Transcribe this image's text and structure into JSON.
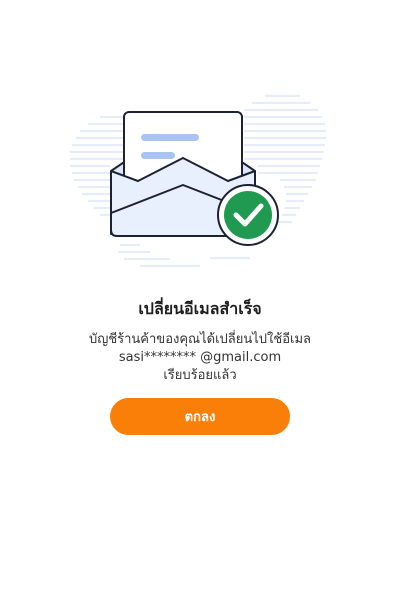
{
  "dialog": {
    "title": "เปลี่ยนอีเมลสำเร็จ",
    "message_line1": "บัญชีร้านค้าของคุณได้เปลี่ยนไปใช้อีเมล",
    "message_email": "sasi******** @gmail.com",
    "message_line3": "เรียบร้อยแล้ว",
    "ok_label": "ตกลง"
  },
  "illustration": {
    "icons": [
      "envelope-icon",
      "checkmark-icon"
    ]
  },
  "colors": {
    "accent": "#f97f08",
    "success": "#1f9a50",
    "envelope_fill": "#e8effd",
    "envelope_lines": "#a9c3f3"
  }
}
